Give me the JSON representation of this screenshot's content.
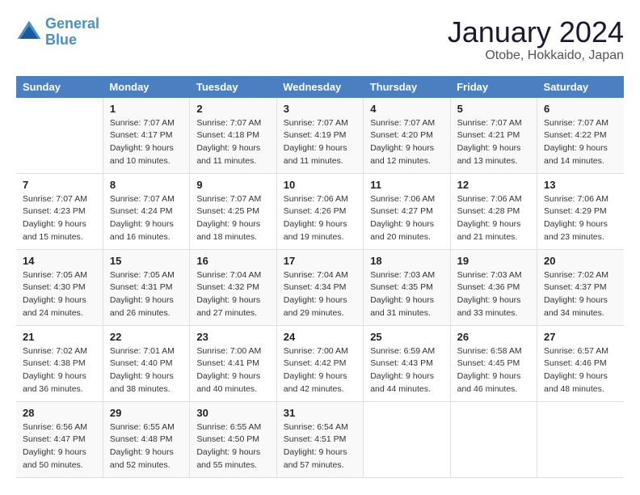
{
  "logo": {
    "line1": "General",
    "line2": "Blue"
  },
  "title": "January 2024",
  "location": "Otobe, Hokkaido, Japan",
  "weekdays": [
    "Sunday",
    "Monday",
    "Tuesday",
    "Wednesday",
    "Thursday",
    "Friday",
    "Saturday"
  ],
  "weeks": [
    [
      {
        "day": "",
        "sunrise": "",
        "sunset": "",
        "daylight": ""
      },
      {
        "day": "1",
        "sunrise": "Sunrise: 7:07 AM",
        "sunset": "Sunset: 4:17 PM",
        "daylight": "Daylight: 9 hours and 10 minutes."
      },
      {
        "day": "2",
        "sunrise": "Sunrise: 7:07 AM",
        "sunset": "Sunset: 4:18 PM",
        "daylight": "Daylight: 9 hours and 11 minutes."
      },
      {
        "day": "3",
        "sunrise": "Sunrise: 7:07 AM",
        "sunset": "Sunset: 4:19 PM",
        "daylight": "Daylight: 9 hours and 11 minutes."
      },
      {
        "day": "4",
        "sunrise": "Sunrise: 7:07 AM",
        "sunset": "Sunset: 4:20 PM",
        "daylight": "Daylight: 9 hours and 12 minutes."
      },
      {
        "day": "5",
        "sunrise": "Sunrise: 7:07 AM",
        "sunset": "Sunset: 4:21 PM",
        "daylight": "Daylight: 9 hours and 13 minutes."
      },
      {
        "day": "6",
        "sunrise": "Sunrise: 7:07 AM",
        "sunset": "Sunset: 4:22 PM",
        "daylight": "Daylight: 9 hours and 14 minutes."
      }
    ],
    [
      {
        "day": "7",
        "sunrise": "Sunrise: 7:07 AM",
        "sunset": "Sunset: 4:23 PM",
        "daylight": "Daylight: 9 hours and 15 minutes."
      },
      {
        "day": "8",
        "sunrise": "Sunrise: 7:07 AM",
        "sunset": "Sunset: 4:24 PM",
        "daylight": "Daylight: 9 hours and 16 minutes."
      },
      {
        "day": "9",
        "sunrise": "Sunrise: 7:07 AM",
        "sunset": "Sunset: 4:25 PM",
        "daylight": "Daylight: 9 hours and 18 minutes."
      },
      {
        "day": "10",
        "sunrise": "Sunrise: 7:06 AM",
        "sunset": "Sunset: 4:26 PM",
        "daylight": "Daylight: 9 hours and 19 minutes."
      },
      {
        "day": "11",
        "sunrise": "Sunrise: 7:06 AM",
        "sunset": "Sunset: 4:27 PM",
        "daylight": "Daylight: 9 hours and 20 minutes."
      },
      {
        "day": "12",
        "sunrise": "Sunrise: 7:06 AM",
        "sunset": "Sunset: 4:28 PM",
        "daylight": "Daylight: 9 hours and 21 minutes."
      },
      {
        "day": "13",
        "sunrise": "Sunrise: 7:06 AM",
        "sunset": "Sunset: 4:29 PM",
        "daylight": "Daylight: 9 hours and 23 minutes."
      }
    ],
    [
      {
        "day": "14",
        "sunrise": "Sunrise: 7:05 AM",
        "sunset": "Sunset: 4:30 PM",
        "daylight": "Daylight: 9 hours and 24 minutes."
      },
      {
        "day": "15",
        "sunrise": "Sunrise: 7:05 AM",
        "sunset": "Sunset: 4:31 PM",
        "daylight": "Daylight: 9 hours and 26 minutes."
      },
      {
        "day": "16",
        "sunrise": "Sunrise: 7:04 AM",
        "sunset": "Sunset: 4:32 PM",
        "daylight": "Daylight: 9 hours and 27 minutes."
      },
      {
        "day": "17",
        "sunrise": "Sunrise: 7:04 AM",
        "sunset": "Sunset: 4:34 PM",
        "daylight": "Daylight: 9 hours and 29 minutes."
      },
      {
        "day": "18",
        "sunrise": "Sunrise: 7:03 AM",
        "sunset": "Sunset: 4:35 PM",
        "daylight": "Daylight: 9 hours and 31 minutes."
      },
      {
        "day": "19",
        "sunrise": "Sunrise: 7:03 AM",
        "sunset": "Sunset: 4:36 PM",
        "daylight": "Daylight: 9 hours and 33 minutes."
      },
      {
        "day": "20",
        "sunrise": "Sunrise: 7:02 AM",
        "sunset": "Sunset: 4:37 PM",
        "daylight": "Daylight: 9 hours and 34 minutes."
      }
    ],
    [
      {
        "day": "21",
        "sunrise": "Sunrise: 7:02 AM",
        "sunset": "Sunset: 4:38 PM",
        "daylight": "Daylight: 9 hours and 36 minutes."
      },
      {
        "day": "22",
        "sunrise": "Sunrise: 7:01 AM",
        "sunset": "Sunset: 4:40 PM",
        "daylight": "Daylight: 9 hours and 38 minutes."
      },
      {
        "day": "23",
        "sunrise": "Sunrise: 7:00 AM",
        "sunset": "Sunset: 4:41 PM",
        "daylight": "Daylight: 9 hours and 40 minutes."
      },
      {
        "day": "24",
        "sunrise": "Sunrise: 7:00 AM",
        "sunset": "Sunset: 4:42 PM",
        "daylight": "Daylight: 9 hours and 42 minutes."
      },
      {
        "day": "25",
        "sunrise": "Sunrise: 6:59 AM",
        "sunset": "Sunset: 4:43 PM",
        "daylight": "Daylight: 9 hours and 44 minutes."
      },
      {
        "day": "26",
        "sunrise": "Sunrise: 6:58 AM",
        "sunset": "Sunset: 4:45 PM",
        "daylight": "Daylight: 9 hours and 46 minutes."
      },
      {
        "day": "27",
        "sunrise": "Sunrise: 6:57 AM",
        "sunset": "Sunset: 4:46 PM",
        "daylight": "Daylight: 9 hours and 48 minutes."
      }
    ],
    [
      {
        "day": "28",
        "sunrise": "Sunrise: 6:56 AM",
        "sunset": "Sunset: 4:47 PM",
        "daylight": "Daylight: 9 hours and 50 minutes."
      },
      {
        "day": "29",
        "sunrise": "Sunrise: 6:55 AM",
        "sunset": "Sunset: 4:48 PM",
        "daylight": "Daylight: 9 hours and 52 minutes."
      },
      {
        "day": "30",
        "sunrise": "Sunrise: 6:55 AM",
        "sunset": "Sunset: 4:50 PM",
        "daylight": "Daylight: 9 hours and 55 minutes."
      },
      {
        "day": "31",
        "sunrise": "Sunrise: 6:54 AM",
        "sunset": "Sunset: 4:51 PM",
        "daylight": "Daylight: 9 hours and 57 minutes."
      },
      {
        "day": "",
        "sunrise": "",
        "sunset": "",
        "daylight": ""
      },
      {
        "day": "",
        "sunrise": "",
        "sunset": "",
        "daylight": ""
      },
      {
        "day": "",
        "sunrise": "",
        "sunset": "",
        "daylight": ""
      }
    ]
  ]
}
